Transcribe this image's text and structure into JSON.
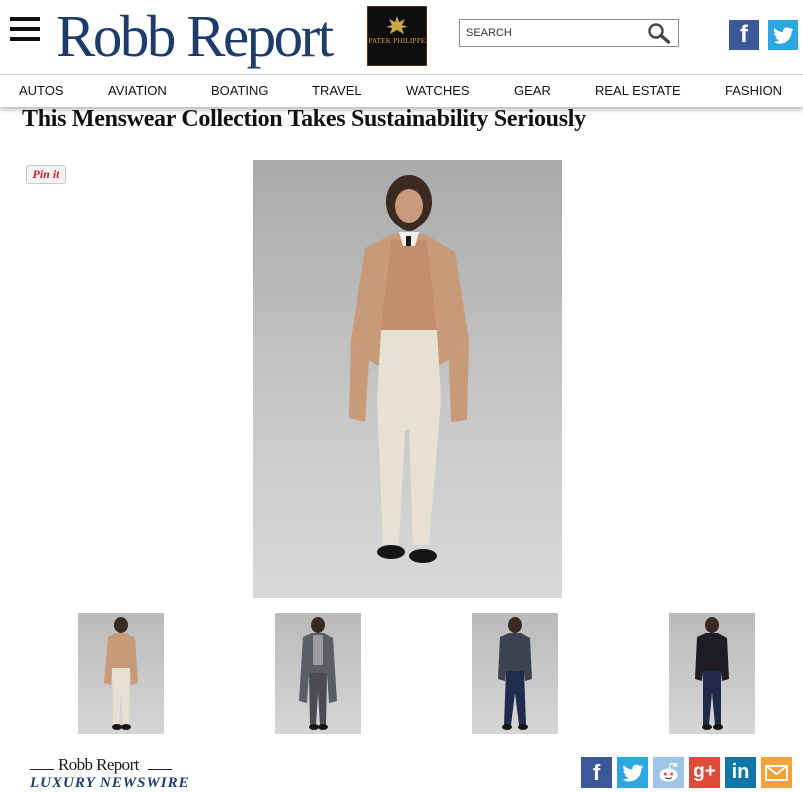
{
  "site": {
    "logo_text": "Robb Report"
  },
  "header": {
    "ad": {
      "brand": "PATEK PHILIPPE",
      "bg_color": "#0d0d0d",
      "accent_color": "#c9a54a"
    },
    "search": {
      "placeholder": "SEARCH"
    },
    "social": [
      {
        "name": "facebook",
        "glyph": "f",
        "color": "#3b5998"
      },
      {
        "name": "twitter",
        "glyph": "t",
        "color": "#2ca7df"
      }
    ]
  },
  "nav": {
    "items": [
      "AUTOS",
      "AVIATION",
      "BOATING",
      "TRAVEL",
      "WATCHES",
      "GEAR",
      "REAL ESTATE",
      "FASHION"
    ]
  },
  "article": {
    "headline": "This Menswear Collection Takes Sustainability Seriously",
    "pin_label": "Pin it",
    "thumbnails": [
      {
        "outfit": "camel coat, cream trousers"
      },
      {
        "outfit": "grey overcoat, grey trousers"
      },
      {
        "outfit": "navy jacket, dark jeans"
      },
      {
        "outfit": "black jacket, dark jeans"
      }
    ]
  },
  "footer": {
    "logo_text": "Robb Report",
    "newswire_text": "LUXURY NEWSWIRE",
    "share": [
      {
        "name": "facebook",
        "glyph": "f",
        "color": "#3b5998"
      },
      {
        "name": "twitter",
        "glyph": "t",
        "color": "#2ca7df"
      },
      {
        "name": "reddit",
        "glyph": "r",
        "color": "#9ec5e8"
      },
      {
        "name": "google-plus",
        "glyph": "g+",
        "color": "#dd4b39"
      },
      {
        "name": "linkedin",
        "glyph": "in",
        "color": "#0e76a8"
      },
      {
        "name": "email",
        "glyph": "",
        "color": "#f4a23c"
      }
    ]
  }
}
